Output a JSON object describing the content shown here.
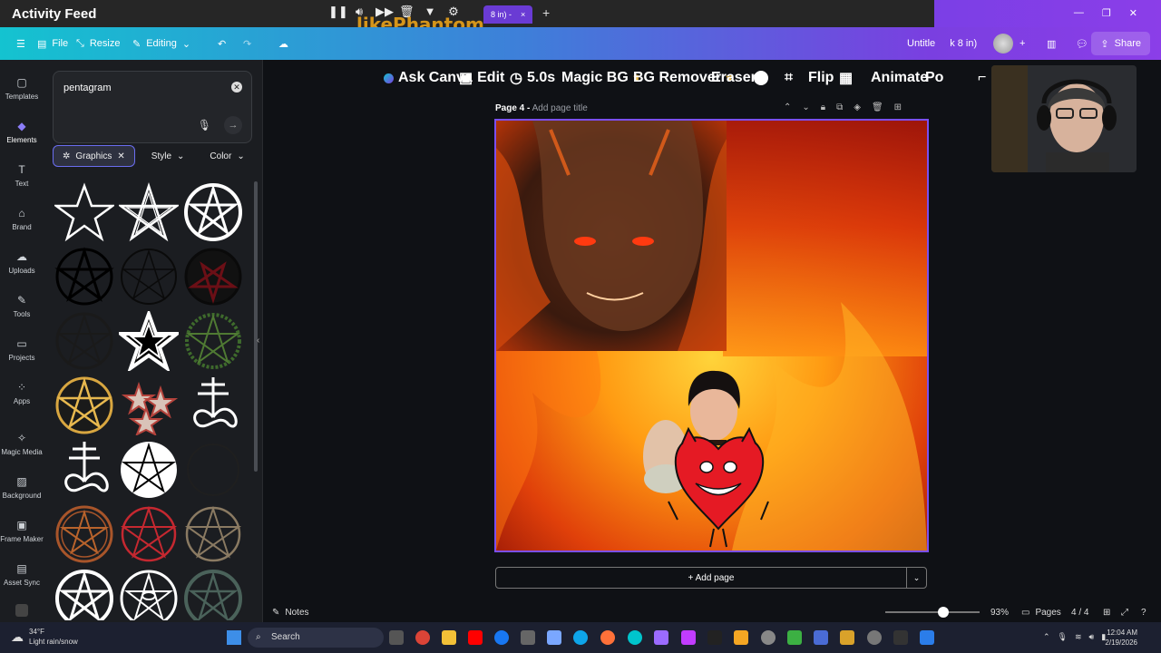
{
  "overlay": {
    "title": "Activity Feed",
    "watermark": "likePhantom",
    "browser_tab": "8 in) -",
    "tab_close": "×",
    "new_tab": "+"
  },
  "header": {
    "file": "File",
    "resize": "Resize",
    "editing": "Editing",
    "doc_title": "Untitle",
    "doc_size": "k 8 in)",
    "share": "Share"
  },
  "rail": [
    {
      "label": "Templates",
      "icon": "template-icon"
    },
    {
      "label": "Elements",
      "icon": "elements-icon"
    },
    {
      "label": "Text",
      "icon": "text-icon"
    },
    {
      "label": "Brand",
      "icon": "brand-icon"
    },
    {
      "label": "Uploads",
      "icon": "upload-icon"
    },
    {
      "label": "Tools",
      "icon": "tools-icon"
    },
    {
      "label": "Projects",
      "icon": "folder-icon"
    },
    {
      "label": "Apps",
      "icon": "apps-icon"
    },
    {
      "label": "Magic Media",
      "icon": "magic-icon"
    },
    {
      "label": "Background",
      "icon": "background-icon"
    },
    {
      "label": "Frame Maker",
      "icon": "frame-icon"
    },
    {
      "label": "Asset Sync",
      "icon": "sync-icon"
    }
  ],
  "panel": {
    "search_value": "pentagram",
    "filters": {
      "graphics": "Graphics",
      "style": "Style",
      "color": "Color"
    }
  },
  "toolbar": {
    "ask_canva": "Ask Canva",
    "edit": "Edit",
    "duration": "5.0s",
    "magic_bg": "Magic BG",
    "bg_remover": "BG Remover",
    "eraser": "Eraser",
    "flip": "Flip",
    "animate": "Animate",
    "position": "Po"
  },
  "page": {
    "label": "Page 4 -",
    "title_placeholder": "Add page title",
    "add_page": "+ Add page"
  },
  "bottom": {
    "notes": "Notes",
    "zoom": "93%",
    "pages": "Pages",
    "page_count": "4 / 4"
  },
  "taskbar": {
    "temp": "34°F",
    "weather": "Light rain/snow",
    "search": "Search",
    "time": "12:04 AM",
    "date": "2/19/2026"
  },
  "colors": {
    "accent": "#7b4ff0",
    "header_start": "#14c3d0",
    "header_end": "#8b3ee8"
  }
}
